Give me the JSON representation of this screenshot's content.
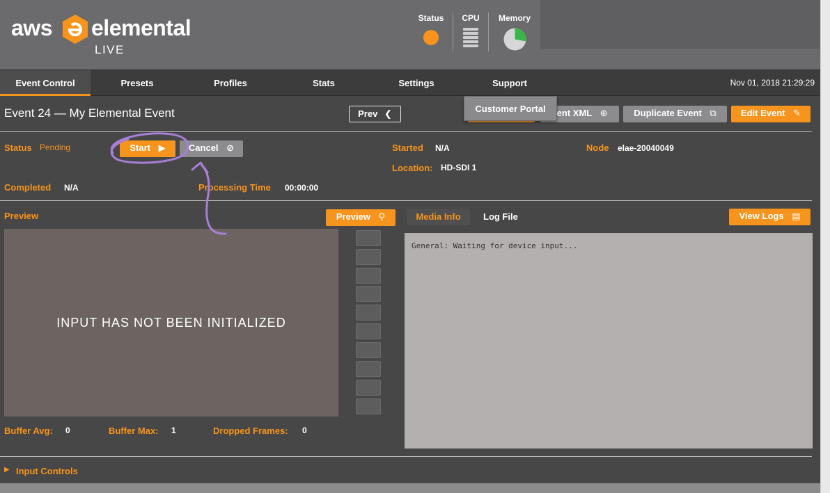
{
  "header": {
    "logo": {
      "aws": "aws",
      "brand": "elemental",
      "product": "LIVE"
    },
    "meters": {
      "status_label": "Status",
      "cpu_label": "CPU",
      "memory_label": "Memory",
      "status_color": "#f7941d",
      "memory_used_fraction": 0.28,
      "memory_used_color": "#3ab54a",
      "memory_free_color": "#d6d6d6"
    }
  },
  "nav": {
    "tabs": [
      "Event Control",
      "Presets",
      "Profiles",
      "Stats",
      "Settings",
      "Support"
    ],
    "active_tab": "Event Control",
    "datetime": "Nov 01, 2018 21:29:29",
    "support_dropdown": {
      "item": "Customer Portal"
    }
  },
  "event": {
    "title": "Event 24 — My Elemental Event",
    "prev_label": "Prev",
    "export_xml_label": "vent XML",
    "duplicate_label": "Duplicate Event",
    "edit_label": "Edit Event",
    "status_label": "Status",
    "status_value": "Pending",
    "start_label": "Start",
    "cancel_label": "Cancel",
    "started_label": "Started",
    "started_value": "N/A",
    "node_label": "Node",
    "node_value": "elae-20040049",
    "location_label": "Location:",
    "location_value": "HD-SDI 1",
    "completed_label": "Completed",
    "completed_value": "N/A",
    "processing_label": "Processing Time",
    "processing_value": "00:00:00"
  },
  "preview": {
    "section_label": "Preview",
    "button_label": "Preview",
    "message": "INPUT HAS NOT BEEN INITIALIZED",
    "buffer_avg_label": "Buffer Avg:",
    "buffer_avg_value": "0",
    "buffer_max_label": "Buffer Max:",
    "buffer_max_value": "1",
    "dropped_label": "Dropped Frames:",
    "dropped_value": "0"
  },
  "info": {
    "media_tab": "Media Info",
    "log_tab": "Log File",
    "view_logs_label": "View Logs",
    "text": "General: Waiting for device input..."
  },
  "footer": {
    "input_controls_label": "Input Controls"
  },
  "annotation": {
    "color": "#a77fd6"
  }
}
